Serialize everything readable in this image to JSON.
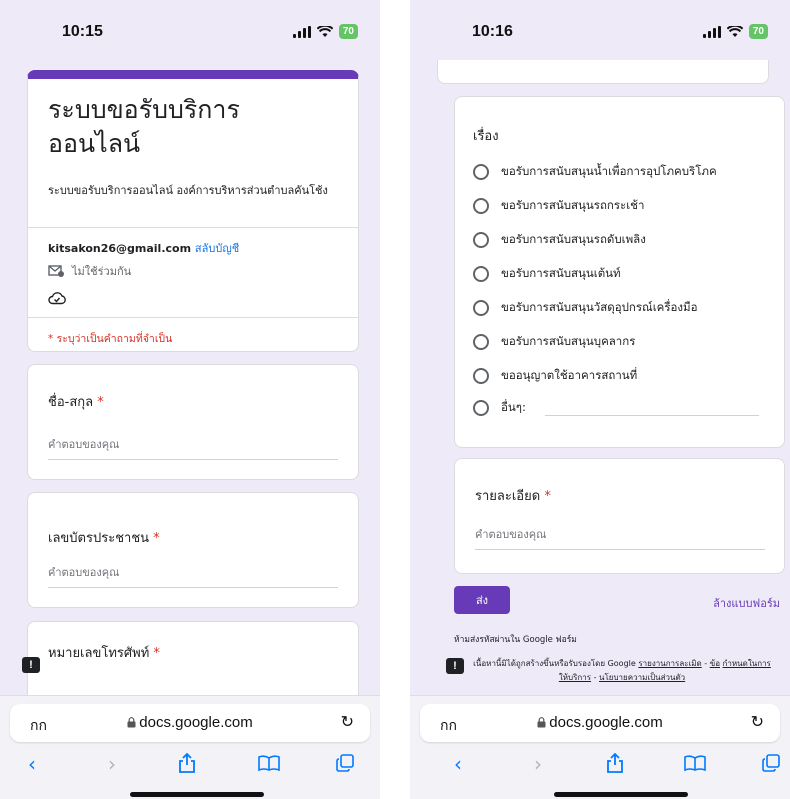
{
  "left": {
    "status": {
      "time": "10:15",
      "battery": "70"
    },
    "header": {
      "title_line1": "ระบบขอรับบริการ",
      "title_line2": "ออนไลน์",
      "description": "ระบบขอรับบริการออนไลน์ องค์การบริหารส่วนตำบลคันโช้ง",
      "email": "kitsakon26@gmail.com",
      "switch_account": "สลับบัญชี",
      "not_shared": "ไม่ใช้ร่วมกัน",
      "required_note": "* ระบุว่าเป็นคำถามที่จำเป็น"
    },
    "questions": [
      {
        "label": "ชื่อ-สกุล",
        "placeholder": "คำตอบของคุณ"
      },
      {
        "label": "เลขบัตรประชาชน",
        "placeholder": "คำตอบของคุณ"
      },
      {
        "label": "หมายเลขโทรศัพท์"
      }
    ],
    "required_mark": "*"
  },
  "right": {
    "status": {
      "time": "10:16",
      "battery": "70"
    },
    "subject": {
      "label": "เรื่อง",
      "options": [
        "ขอรับการสนับสนุนน้ำเพื่อการอุปโภคบริโภค",
        "ขอรับการสนับสนุนรถกระเช้า",
        "ขอรับการสนับสนุนรถดับเพลิง",
        "ขอรับการสนับสนุนเต้นท์",
        "ขอรับการสนับสนุนวัสดุอุปกรณ์เครื่องมือ",
        "ขอรับการสนับสนุนบุคลากร",
        "ขออนุญาตใช้อาคารสถานที่"
      ],
      "other_label": "อื่นๆ:"
    },
    "details": {
      "label": "รายละเอียด",
      "placeholder": "คำตอบของคุณ"
    },
    "submit": "ส่ง",
    "clear_form": "ล้างแบบฟอร์ม",
    "no_password": "ห้ามส่งรหัสผ่านใน Google ฟอร์ม",
    "footer": {
      "text": "เนื้อหานี้มิได้ถูกสร้างขึ้นหรือรับรองโดย Google",
      "report": "รายงานการละเมิด",
      "sep": "-",
      "terms_a": "ข้อ",
      "terms_b": "กำหนดในการให้บริการ",
      "privacy": "นโยบายความเป็นส่วนตัว"
    }
  },
  "browser": {
    "aa": "กก",
    "url": "docs.google.com"
  },
  "colors": {
    "accent": "#673ab7",
    "link": "#1a73e8",
    "required": "#d93025",
    "ios_blue": "#007aff"
  }
}
